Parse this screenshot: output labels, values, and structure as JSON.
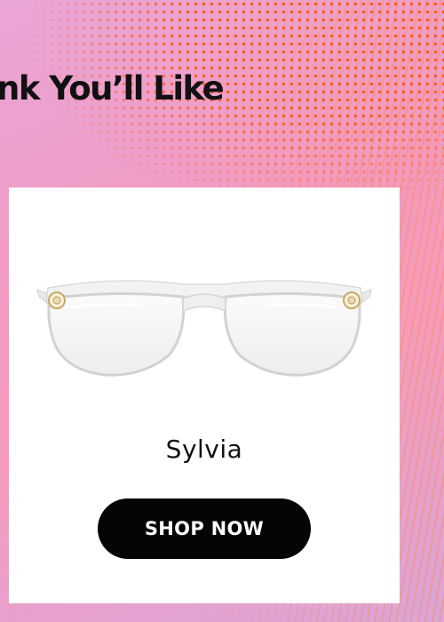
{
  "promo": {
    "headline": "nk You’ll Like"
  },
  "product": {
    "name": "Sylvia",
    "image_icon": "eyeglasses-clear-cat-eye"
  },
  "cta": {
    "label": "SHOP NOW"
  },
  "colors": {
    "background_pink": "#f29ac2",
    "halftone_orange": "#ff5a14",
    "card": "#ffffff",
    "button": "#050505",
    "button_text": "#ffffff",
    "text": "#111111"
  }
}
